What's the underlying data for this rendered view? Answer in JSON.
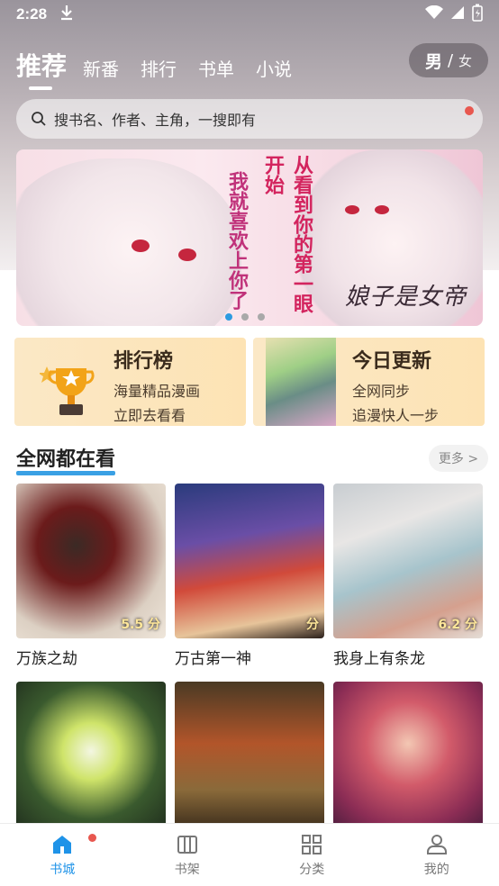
{
  "status": {
    "time": "2:28"
  },
  "tabs": [
    {
      "label": "推荐"
    },
    {
      "label": "新番"
    },
    {
      "label": "排行"
    },
    {
      "label": "书单"
    },
    {
      "label": "小说"
    }
  ],
  "gender": {
    "male": "男",
    "separator": "/",
    "female": "女"
  },
  "search": {
    "placeholder": "搜书名、作者、主角，一搜即有"
  },
  "banner": {
    "slogan_col1": "我就喜欢上你了",
    "slogan_col2": "从看到你的第一眼开始",
    "logo_text": "娘子是女帝",
    "page_count": 3,
    "active_index": 0
  },
  "cards": {
    "ranking": {
      "title": "排行榜",
      "line1": "海量精品漫画",
      "line2": "立即去看看"
    },
    "updates": {
      "title": "今日更新",
      "line1": "全网同步",
      "line2": "追漫快人一步"
    }
  },
  "section": {
    "title": "全网都在看",
    "more": "更多 >"
  },
  "comics": [
    {
      "name": "万族之劫",
      "score": "5.5 分"
    },
    {
      "name": "万古第一神",
      "score": "分"
    },
    {
      "name": "我身上有条龙",
      "score": "6.2 分"
    },
    {
      "name": "",
      "score": ""
    },
    {
      "name": "",
      "score": ""
    },
    {
      "name": "",
      "score": ""
    }
  ],
  "nav": [
    {
      "label": "书城",
      "icon": "home-icon",
      "active": true
    },
    {
      "label": "书架",
      "icon": "bookshelf-icon"
    },
    {
      "label": "分类",
      "icon": "category-icon"
    },
    {
      "label": "我的",
      "icon": "profile-icon"
    }
  ],
  "colors": {
    "accent": "#1f93e8",
    "badge": "#e8574f",
    "underline": "#3aa0e4"
  }
}
